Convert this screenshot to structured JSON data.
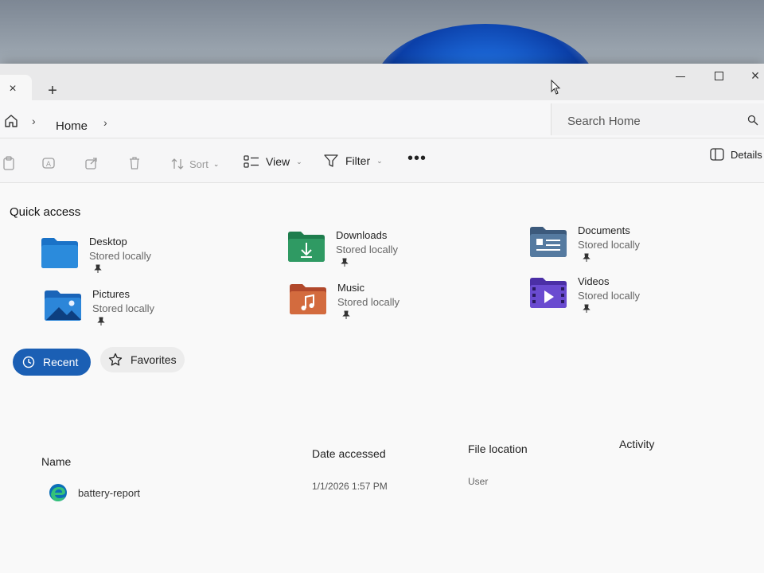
{
  "titlebar": {
    "tab_close": "×",
    "new_tab": "+",
    "minimize": "",
    "maximize": "",
    "close": "×"
  },
  "address": {
    "breadcrumb_home": "Home",
    "search_placeholder": "Search Home"
  },
  "commandbar": {
    "sort_label": "Sort",
    "view_label": "View",
    "filter_label": "Filter",
    "more_label": "•••",
    "details_label": "Details"
  },
  "quick_access": {
    "title": "Quick access",
    "items": [
      {
        "name": "Desktop",
        "status": "Stored locally",
        "icon": "desktop-folder-icon"
      },
      {
        "name": "Downloads",
        "status": "Stored locally",
        "icon": "downloads-folder-icon"
      },
      {
        "name": "Documents",
        "status": "Stored locally",
        "icon": "documents-folder-icon"
      },
      {
        "name": "Pictures",
        "status": "Stored locally",
        "icon": "pictures-folder-icon"
      },
      {
        "name": "Music",
        "status": "Stored locally",
        "icon": "music-folder-icon"
      },
      {
        "name": "Videos",
        "status": "Stored locally",
        "icon": "videos-folder-icon"
      }
    ]
  },
  "tabs": {
    "recent": "Recent",
    "favorites": "Favorites"
  },
  "table": {
    "columns": [
      "Name",
      "Date accessed",
      "File location",
      "Activity"
    ],
    "rows": [
      {
        "name": "battery-report",
        "date": "1/1/2026 1:57 PM",
        "location": "User",
        "icon": "edge-icon"
      }
    ]
  },
  "colors": {
    "accent": "#1b5fb4",
    "window_bg": "#f3f3f3"
  }
}
